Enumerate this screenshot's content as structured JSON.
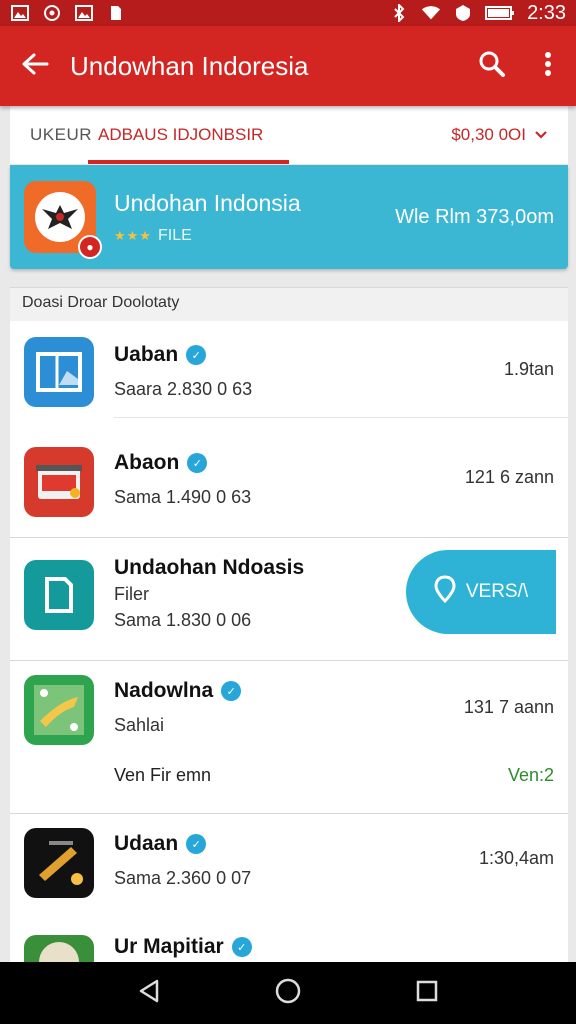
{
  "status_bar": {
    "time": "2:33",
    "left_icons": [
      "image-icon",
      "whatsapp-icon",
      "image-icon",
      "sim-icon"
    ],
    "right_icons": [
      "bluetooth-icon",
      "wifi-icon",
      "alarm-icon",
      "battery-icon"
    ]
  },
  "toolbar": {
    "title": "Undowhan Indoresia",
    "back_icon": "arrow-left-icon",
    "search_icon": "search-icon",
    "menu_icon": "more-vert-icon"
  },
  "tabs": {
    "left_label": "UKEUR",
    "active_label": "ADBAUS IDJONBSIR",
    "filter_label": "$0,30 0OI"
  },
  "banner": {
    "title": "Undohan Indonsia",
    "stars": "★★★",
    "sub": "FILE",
    "right": "Wle Rlm 373,0om"
  },
  "section": {
    "title": "Doasi Droar Doolotaty"
  },
  "rows": [
    {
      "title": "Uaban",
      "sub": "Saara 2.830 0 63",
      "right": "1.9tan"
    },
    {
      "title": "Abaon",
      "sub": "Sama 1.490 0 63",
      "right": "121 6 zann"
    },
    {
      "title": "Undaohan Ndoasis",
      "sub1": "Filer",
      "sub2": "Sama 1.830 0 06",
      "button": "VERS/\\"
    },
    {
      "title": "Nadowlna",
      "sub": "Sahlai",
      "right": "131 7 aann",
      "extra_left": "Ven Fir emn",
      "extra_right": "Ven:2"
    },
    {
      "title": "Udaan",
      "sub": "Sama 2.360 0 07",
      "right": "1:30,4am"
    },
    {
      "title": "Ur Mapitiar"
    }
  ],
  "colors": {
    "status": "#b71c1c",
    "toolbar": "#d32622",
    "banner": "#3bb6d3",
    "accent_green": "#2e8b2e"
  }
}
